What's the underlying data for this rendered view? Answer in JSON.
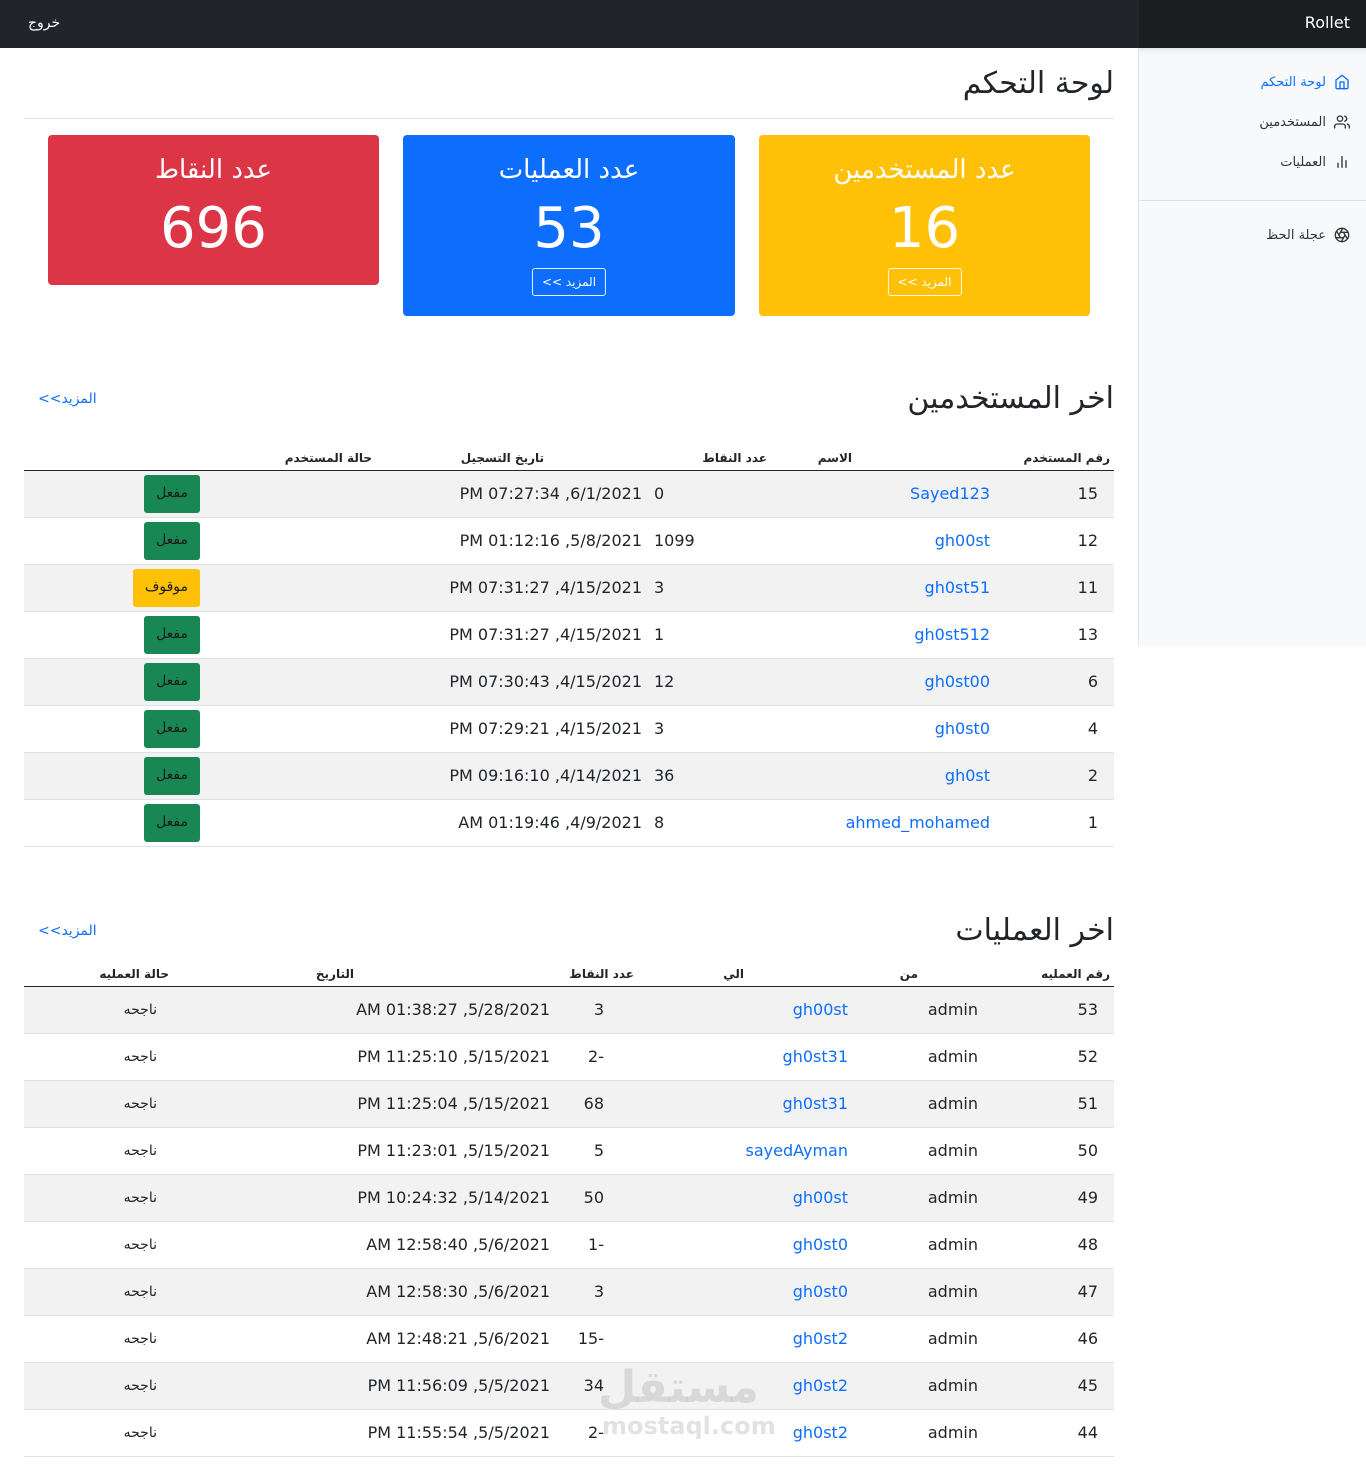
{
  "navbar": {
    "brand": "Rollet",
    "logout": "خروج"
  },
  "sidebar": {
    "items": [
      {
        "label": "لوحة التحكم",
        "icon": "home-icon",
        "active": true
      },
      {
        "label": "المستخدمين",
        "icon": "users-icon",
        "active": false
      },
      {
        "label": "العمليات",
        "icon": "bar-chart-icon",
        "active": false
      }
    ],
    "extra": {
      "label": "عجلة الحظ",
      "icon": "aperture-icon"
    }
  },
  "page": {
    "title": "لوحة التحكم"
  },
  "cards": {
    "users": {
      "title": "عدد المستخدمين",
      "value": "16",
      "more": "المزيد >>",
      "color": "#ffc107"
    },
    "operations": {
      "title": "عدد العمليات",
      "value": "53",
      "more": "المزيد >>",
      "color": "#0d6efd"
    },
    "points": {
      "title": "عدد النقاط",
      "value": "696",
      "color": "#dc3545"
    }
  },
  "latest_users": {
    "title": "اخر المستخدمين",
    "more": "المزيد>>",
    "headers": [
      "رقم المستخدم",
      "الاسم",
      "عدد النقاط",
      "تاريخ التسجيل",
      "حالة المستخدم"
    ],
    "rows": [
      {
        "id": "15",
        "name": "Sayed123",
        "points": "0",
        "date": "6/1/2021, 07:27:34 PM",
        "status": "مفعل"
      },
      {
        "id": "12",
        "name": "gh00st",
        "points": "1099",
        "date": "5/8/2021, 01:12:16 PM",
        "status": "مفعل"
      },
      {
        "id": "11",
        "name": "gh0st51",
        "points": "3",
        "date": "4/15/2021, 07:31:27 PM",
        "status": "موقوف"
      },
      {
        "id": "13",
        "name": "gh0st512",
        "points": "1",
        "date": "4/15/2021, 07:31:27 PM",
        "status": "مفعل"
      },
      {
        "id": "6",
        "name": "gh0st00",
        "points": "12",
        "date": "4/15/2021, 07:30:43 PM",
        "status": "مفعل"
      },
      {
        "id": "4",
        "name": "gh0st0",
        "points": "3",
        "date": "4/15/2021, 07:29:21 PM",
        "status": "مفعل"
      },
      {
        "id": "2",
        "name": "gh0st",
        "points": "36",
        "date": "4/14/2021, 09:16:10 PM",
        "status": "مفعل"
      },
      {
        "id": "1",
        "name": "ahmed_mohamed",
        "points": "8",
        "date": "4/9/2021, 01:19:46 AM",
        "status": "مفعل"
      }
    ]
  },
  "latest_operations": {
    "title": "اخر العمليات",
    "more": "المزيد>>",
    "headers": [
      "رقم العمليه",
      "من",
      "الي",
      "عدد النقاط",
      "التاريخ",
      "حالة العمليه"
    ],
    "rows": [
      {
        "id": "53",
        "from": "admin",
        "to": "gh00st",
        "points": "3",
        "date": "5/28/2021, 01:38:27 AM",
        "status": "ناجحه"
      },
      {
        "id": "52",
        "from": "admin",
        "to": "gh0st31",
        "points": "-2",
        "date": "5/15/2021, 11:25:10 PM",
        "status": "ناجحه"
      },
      {
        "id": "51",
        "from": "admin",
        "to": "gh0st31",
        "points": "68",
        "date": "5/15/2021, 11:25:04 PM",
        "status": "ناجحه"
      },
      {
        "id": "50",
        "from": "admin",
        "to": "sayedAyman",
        "points": "5",
        "date": "5/15/2021, 11:23:01 PM",
        "status": "ناجحه"
      },
      {
        "id": "49",
        "from": "admin",
        "to": "gh00st",
        "points": "50",
        "date": "5/14/2021, 10:24:32 PM",
        "status": "ناجحه"
      },
      {
        "id": "48",
        "from": "admin",
        "to": "gh0st0",
        "points": "-1",
        "date": "5/6/2021, 12:58:40 AM",
        "status": "ناجحه"
      },
      {
        "id": "47",
        "from": "admin",
        "to": "gh0st0",
        "points": "3",
        "date": "5/6/2021, 12:58:30 AM",
        "status": "ناجحه"
      },
      {
        "id": "46",
        "from": "admin",
        "to": "gh0st2",
        "points": "-15",
        "date": "5/6/2021, 12:48:21 AM",
        "status": "ناجحه"
      },
      {
        "id": "45",
        "from": "admin",
        "to": "gh0st2",
        "points": "34",
        "date": "5/5/2021, 11:56:09 PM",
        "status": "ناجحه"
      },
      {
        "id": "44",
        "from": "admin",
        "to": "gh0st2",
        "points": "-2",
        "date": "5/5/2021, 11:55:54 PM",
        "status": "ناجحه"
      }
    ]
  },
  "watermark": {
    "arabic": "مستقل",
    "latin": "mostaql.com"
  }
}
